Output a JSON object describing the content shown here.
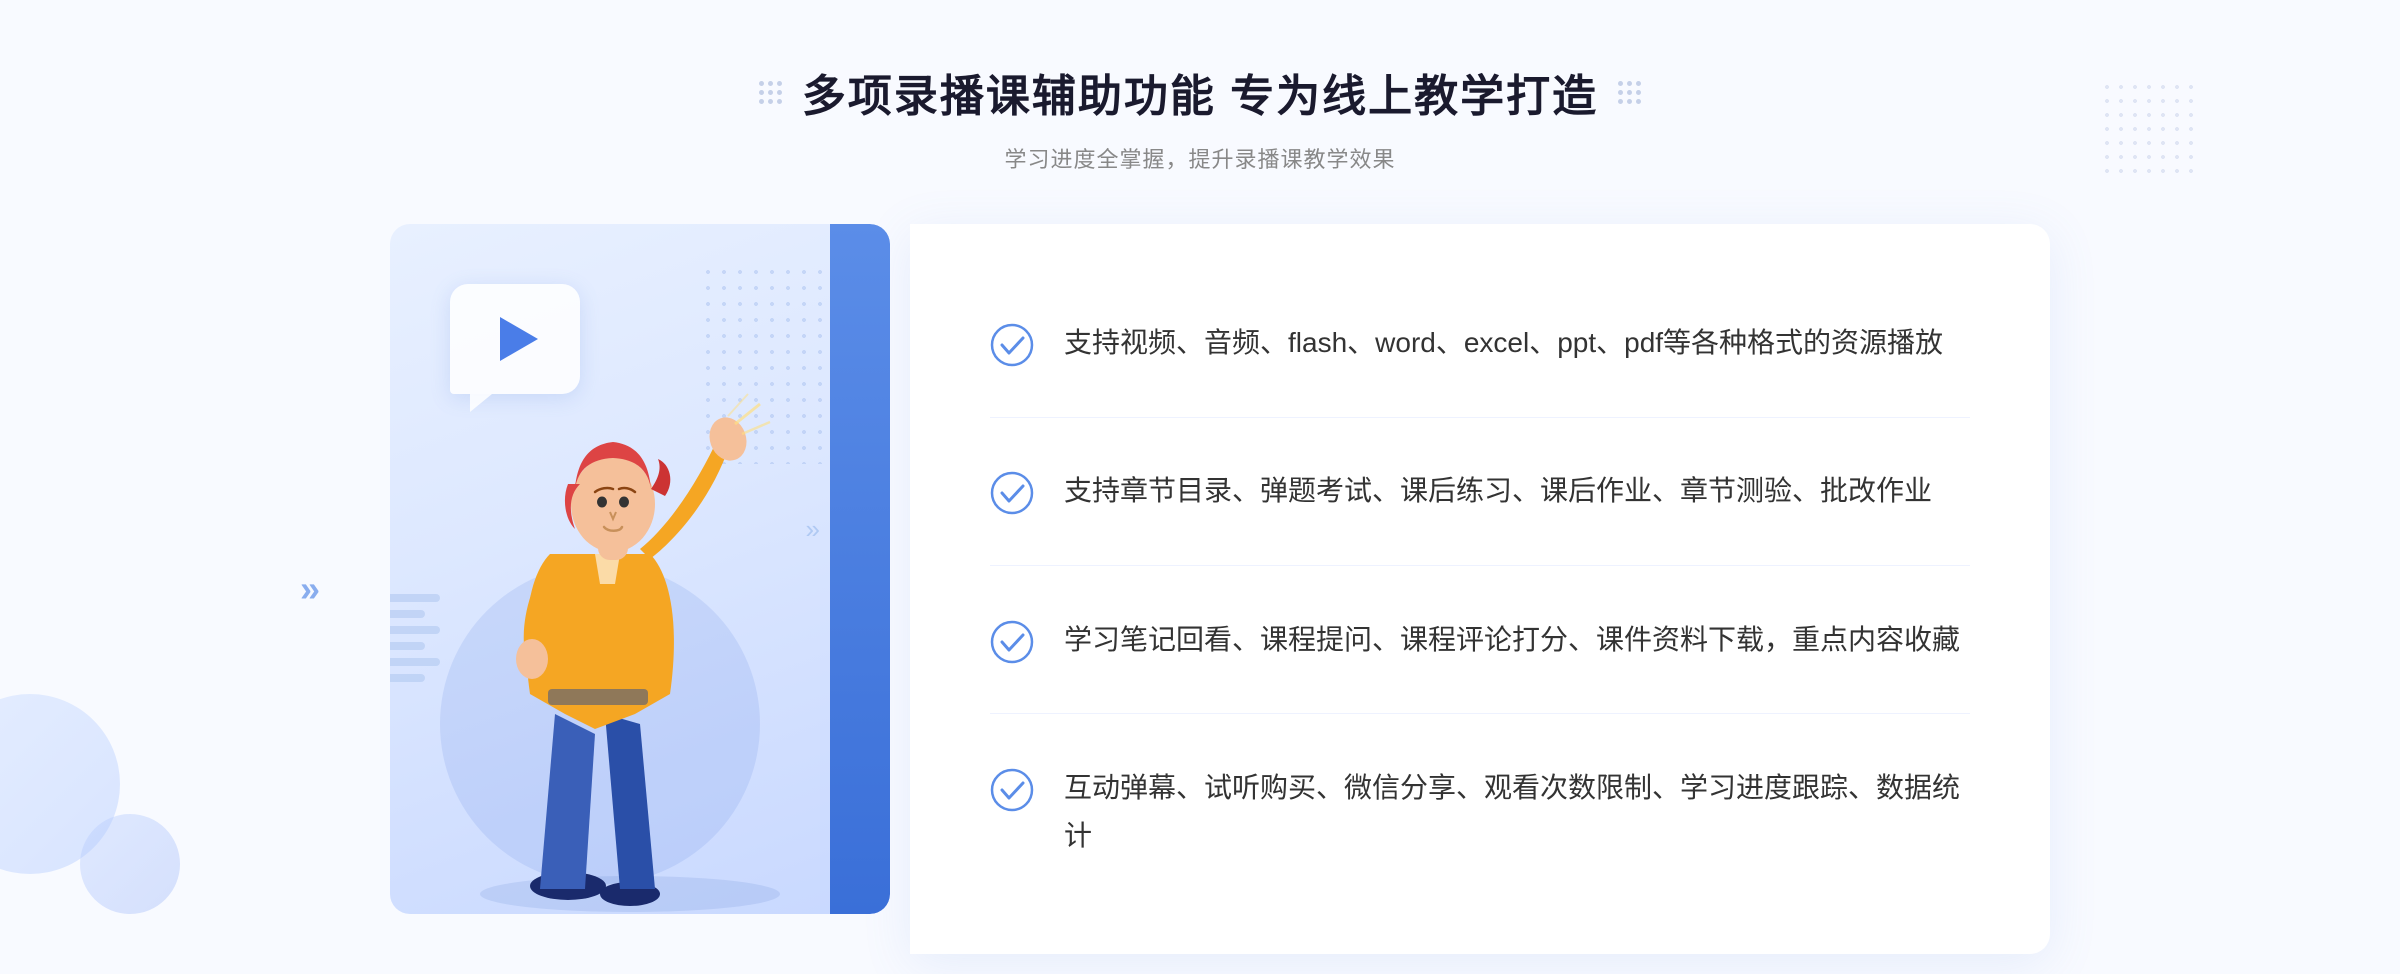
{
  "page": {
    "background": "#f8faff"
  },
  "header": {
    "title": "多项录播课辅助功能 专为线上教学打造",
    "subtitle": "学习进度全掌握，提升录播课教学效果",
    "dots_left": "decorative",
    "dots_right": "decorative"
  },
  "features": [
    {
      "id": 1,
      "text": "支持视频、音频、flash、word、excel、ppt、pdf等各种格式的资源播放"
    },
    {
      "id": 2,
      "text": "支持章节目录、弹题考试、课后练习、课后作业、章节测验、批改作业"
    },
    {
      "id": 3,
      "text": "学习笔记回看、课程提问、课程评论打分、课件资料下载，重点内容收藏"
    },
    {
      "id": 4,
      "text": "互动弹幕、试听购买、微信分享、观看次数限制、学习进度跟踪、数据统计"
    }
  ],
  "icons": {
    "check_circle": "check-circle-icon",
    "play": "play-icon",
    "arrow_left": "chevron-left-icon",
    "arrow_right": "chevron-right-icon"
  },
  "colors": {
    "primary": "#4a7de8",
    "primary_dark": "#3a6fd8",
    "text_dark": "#1a1a2e",
    "text_body": "#333333",
    "text_subtitle": "#888888",
    "bg_light": "#f8faff",
    "card_bg": "#ffffff",
    "illus_bg": "#dde8ff",
    "check_color": "#5b8de8"
  }
}
